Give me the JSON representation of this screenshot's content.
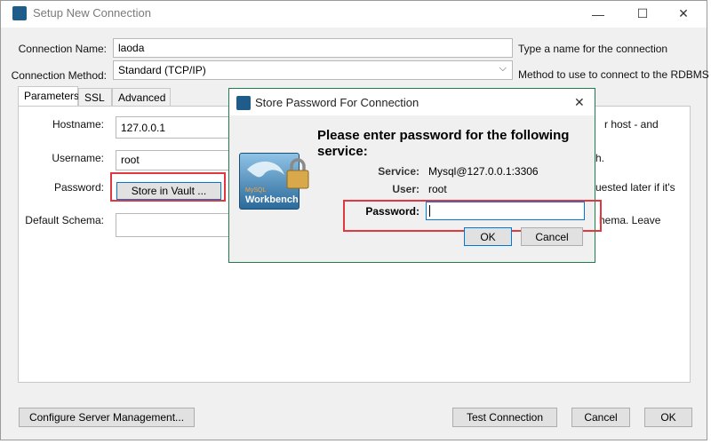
{
  "window": {
    "title": "Setup New Connection",
    "minimize": "—",
    "maximize": "☐",
    "close": "✕"
  },
  "form": {
    "connection_name_label": "Connection Name:",
    "connection_name_value": "laoda",
    "connection_name_hint": "Type a name for the connection",
    "connection_method_label": "Connection Method:",
    "connection_method_value": "Standard (TCP/IP)",
    "connection_method_hint": "Method to use to connect to the RDBMS"
  },
  "tabs": [
    {
      "label": "Parameters"
    },
    {
      "label": "SSL"
    },
    {
      "label": "Advanced"
    }
  ],
  "params": {
    "hostname_label": "Hostname:",
    "hostname_value": "127.0.0.1",
    "hostname_hint_partial": "r host - and",
    "username_label": "Username:",
    "username_value": "root",
    "username_hint_partial": "h.",
    "password_label": "Password:",
    "store_vault_button": "Store in Vault ...",
    "password_hint_partial": "uested later if it's",
    "schema_label": "Default Schema:",
    "schema_value": "",
    "schema_hint_partial": "hema. Leave"
  },
  "dialog": {
    "title": "Store Password For Connection",
    "close": "✕",
    "heading": "Please enter password for the following service:",
    "service_label": "Service:",
    "service_value": "Mysql@127.0.0.1:3306",
    "user_label": "User:",
    "user_value": "root",
    "password_label": "Password:",
    "password_value": "",
    "ok_button": "OK",
    "cancel_button": "Cancel",
    "logo_text_small": "MySQL",
    "logo_text": "Workbench"
  },
  "footer": {
    "configure_button": "Configure Server Management...",
    "test_button": "Test Connection",
    "cancel_button": "Cancel",
    "ok_button": "OK"
  },
  "colors": {
    "highlight_red": "#e0383e",
    "focus_blue": "#0078d7",
    "dialog_border": "#1f7a4f"
  }
}
